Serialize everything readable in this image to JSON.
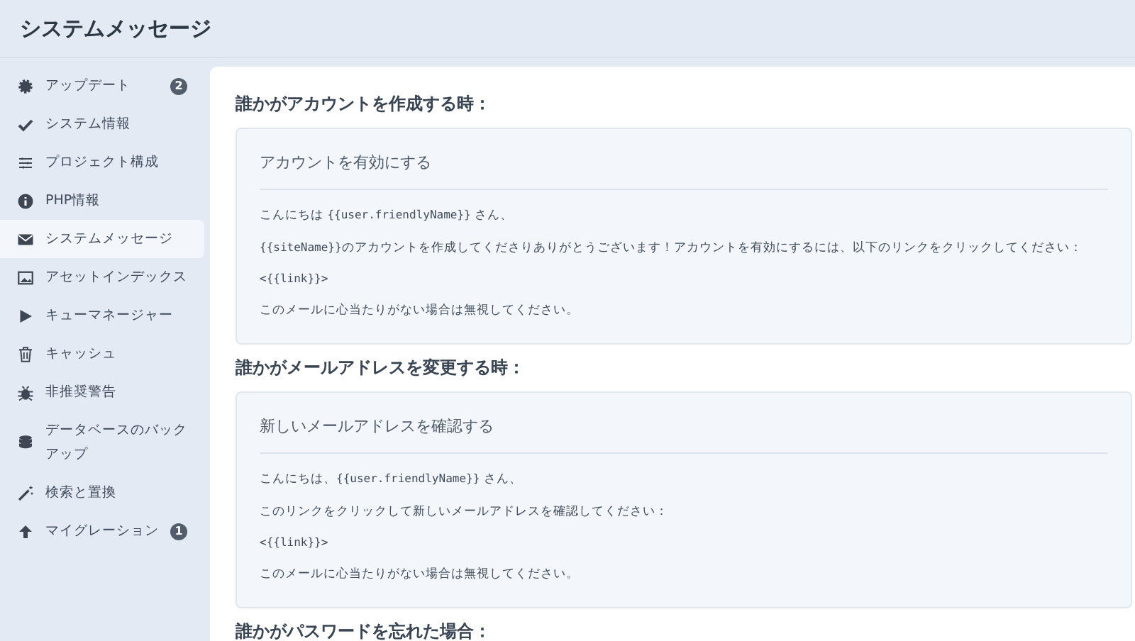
{
  "page_title": "システムメッセージ",
  "sidebar": {
    "items": [
      {
        "label": "アップデート",
        "badge": "2",
        "selected": false
      },
      {
        "label": "システム情報",
        "selected": false
      },
      {
        "label": "プロジェクト構成",
        "selected": false
      },
      {
        "label": "PHP情報",
        "selected": false
      },
      {
        "label": "システムメッセージ",
        "selected": true
      },
      {
        "label": "アセットインデックス",
        "selected": false
      },
      {
        "label": "キューマネージャー",
        "selected": false
      },
      {
        "label": "キャッシュ",
        "selected": false
      },
      {
        "label": "非推奨警告",
        "selected": false
      },
      {
        "label": "データベースのバックアップ",
        "selected": false
      },
      {
        "label": "検索と置換",
        "selected": false
      },
      {
        "label": "マイグレーション",
        "badge": "1",
        "selected": false
      }
    ]
  },
  "messages": [
    {
      "heading": "誰かがアカウントを作成する時：",
      "subject": "アカウントを有効にする",
      "body": [
        [
          {
            "kind": "text",
            "text": "こんにちは "
          },
          {
            "kind": "code",
            "text": "{{user.friendlyName}}"
          },
          {
            "kind": "text",
            "text": " さん、"
          }
        ],
        [
          {
            "kind": "code",
            "text": "{{siteName}}"
          },
          {
            "kind": "text",
            "text": "のアカウントを作成してくださりありがとうございます！アカウントを有効にするには、以下のリンクをクリックしてください："
          }
        ],
        [
          {
            "kind": "code",
            "text": "<{{link}}>"
          }
        ],
        [
          {
            "kind": "text",
            "text": "このメールに心当たりがない場合は無視してください。"
          }
        ]
      ]
    },
    {
      "heading": "誰かがメールアドレスを変更する時：",
      "subject": "新しいメールアドレスを確認する",
      "body": [
        [
          {
            "kind": "text",
            "text": "こんにちは、"
          },
          {
            "kind": "code",
            "text": "{{user.friendlyName}}"
          },
          {
            "kind": "text",
            "text": " さん、"
          }
        ],
        [
          {
            "kind": "text",
            "text": "このリンクをクリックして新しいメールアドレスを確認してください："
          }
        ],
        [
          {
            "kind": "code",
            "text": "<{{link}}>"
          }
        ],
        [
          {
            "kind": "text",
            "text": "このメールに心当たりがない場合は無視してください。"
          }
        ]
      ]
    },
    {
      "heading": "誰かがパスワードを忘れた場合："
    }
  ]
}
